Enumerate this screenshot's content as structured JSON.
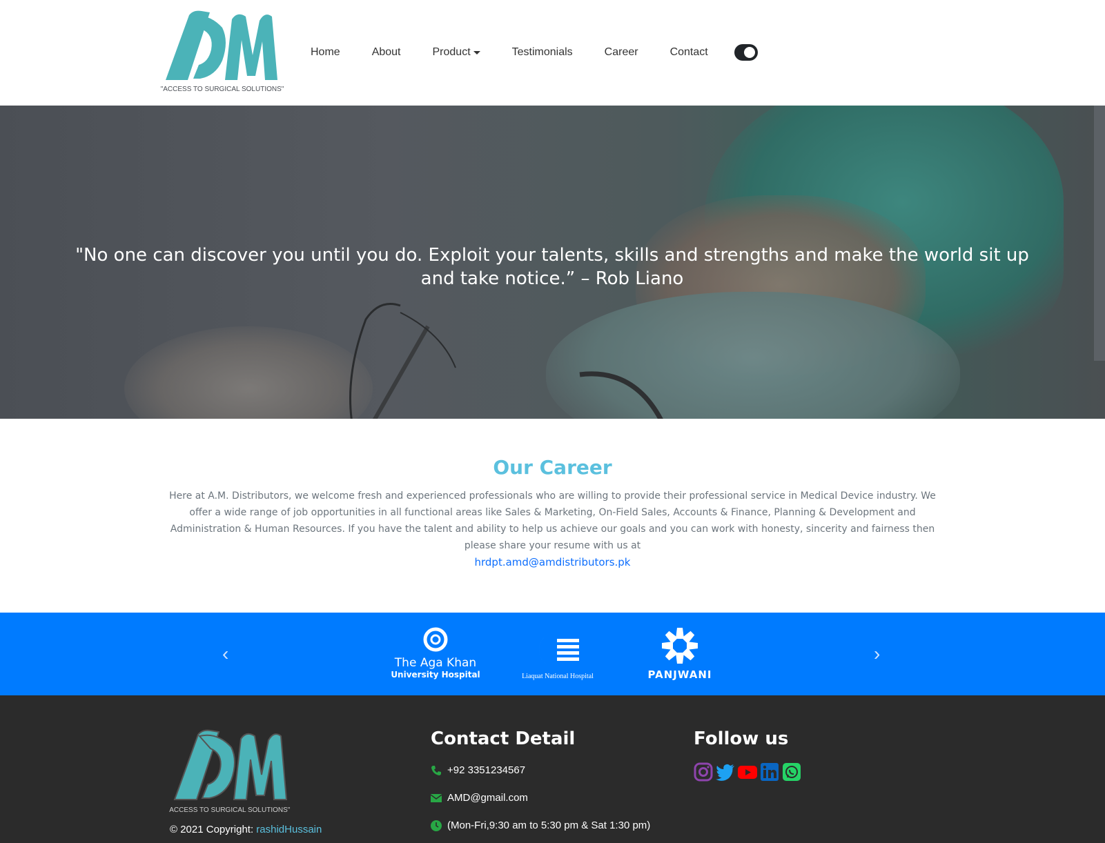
{
  "nav": {
    "logo_tagline": "\"ACCESS TO SURGICAL SOLUTIONS\"",
    "links": [
      "Home",
      "About",
      "Product",
      "Testimonials",
      "Career",
      "Contact"
    ]
  },
  "hero": {
    "quote": "\"No one can discover you until you do. Exploit your talents, skills and strengths and make the world sit up and take notice.” – Rob Liano"
  },
  "career": {
    "title": "Our Career",
    "text": "Here at A.M. Distributors, we welcome fresh and experienced professionals who are willing to provide their professional service in Medical Device industry. We offer a wide range of job opportunities in all functional areas like Sales & Marketing, On-Field Sales, Accounts & Finance, Planning & Development and Administration & Human Resources. If you have the talent and ability to help us achieve our goals and you can work with honesty, sincerity and fairness then please share your resume with us at",
    "email": "hrdpt.amd@amdistributors.pk"
  },
  "partners": {
    "aga_khan_line1": "The Aga Khan",
    "aga_khan_line2": "University Hospital",
    "liaquat": "Liaquat National Hospital",
    "panjwani": "PANJWANI"
  },
  "footer": {
    "logo_tagline": "\"ACCESS TO SURGICAL SOLUTIONS\"",
    "copyright_prefix": "© 2021 Copyright: ",
    "copyright_author": "rashidHussain",
    "contact_title": "Contact Detail",
    "phone": "+92 3351234567",
    "email": "AMD@gmail.com",
    "hours": "(Mon-Fri,9:30 am to 5:30 pm & Sat 1:30 pm)",
    "follow_title": "Follow us",
    "socials": [
      "instagram-icon",
      "twitter-icon",
      "youtube-icon",
      "linkedin-icon",
      "whatsapp-icon"
    ]
  },
  "colors": {
    "brand_teal": "#4bb3b8",
    "accent_blue": "#007bff",
    "career_title": "#5bc0de",
    "footer_bg": "#2b2b2b"
  }
}
